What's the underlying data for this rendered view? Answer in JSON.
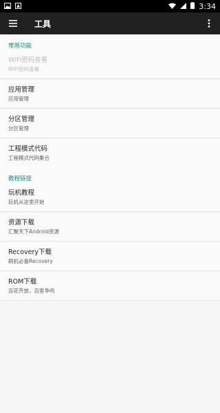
{
  "status_bar": {
    "time": "3:34"
  },
  "toolbar": {
    "title": "工具"
  },
  "sections": [
    {
      "header": "常用功能",
      "items": [
        {
          "title": "WiFi密码查看",
          "subtitle": "WiFi密码查看",
          "enabled": false
        },
        {
          "title": "应用管理",
          "subtitle": "应用管理",
          "enabled": true
        },
        {
          "title": "分区管理",
          "subtitle": "分区管理",
          "enabled": true
        },
        {
          "title": "工程模式代码",
          "subtitle": "工程模式代码集合",
          "enabled": true
        }
      ]
    },
    {
      "header": "教程链接",
      "items": [
        {
          "title": "玩机教程",
          "subtitle": "玩机从这里开始",
          "enabled": true
        },
        {
          "title": "资源下载",
          "subtitle": "汇聚天下Android资源",
          "enabled": true
        },
        {
          "title": "Recovery下载",
          "subtitle": "刷机必备Recovery",
          "enabled": true
        },
        {
          "title": "ROM下载",
          "subtitle": "百花齐放，百家争鸣",
          "enabled": true
        }
      ]
    }
  ],
  "colors": {
    "accent": "#1a8a7d",
    "toolbar": "#212121"
  },
  "icons": [
    "image-icon",
    "notification-icon",
    "wifi-icon",
    "signal-icon",
    "battery-icon",
    "menu-icon",
    "more-vert-icon"
  ]
}
